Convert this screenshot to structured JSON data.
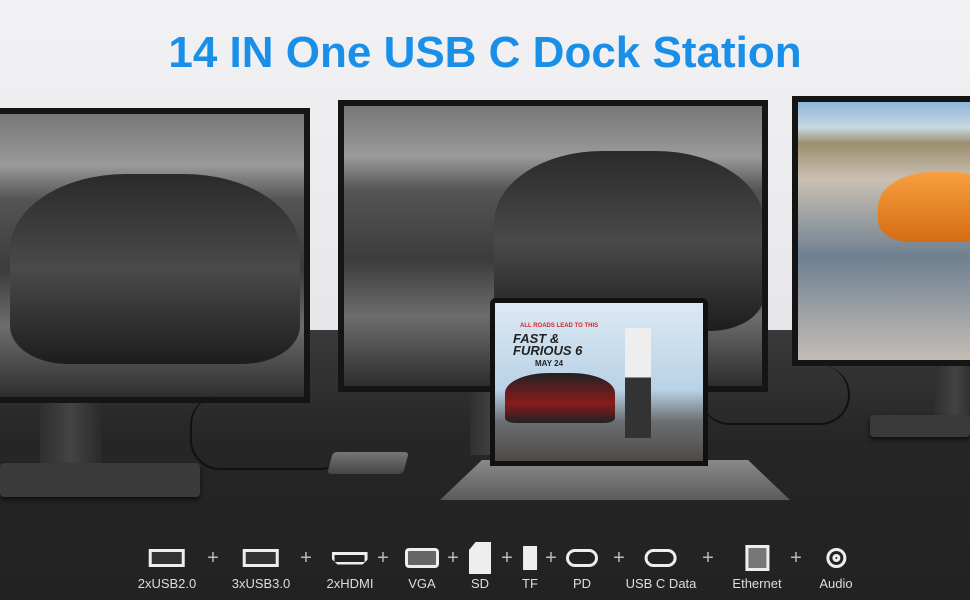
{
  "title": "14 IN One USB C Dock Station",
  "laptop_poster": {
    "tagline": "ALL ROADS LEAD TO THIS",
    "title": "FAST & FURIOUS 6",
    "date": "MAY 24"
  },
  "ports": [
    {
      "label": "2xUSB2.0",
      "icon": "usb-a-icon"
    },
    {
      "label": "3xUSB3.0",
      "icon": "usb-a-icon"
    },
    {
      "label": "2xHDMI",
      "icon": "hdmi-icon"
    },
    {
      "label": "VGA",
      "icon": "vga-icon"
    },
    {
      "label": "SD",
      "icon": "sd-card-icon"
    },
    {
      "label": "TF",
      "icon": "tf-card-icon"
    },
    {
      "label": "PD",
      "icon": "usb-c-icon"
    },
    {
      "label": "USB C Data",
      "icon": "usb-c-icon"
    },
    {
      "label": "Ethernet",
      "icon": "ethernet-icon"
    },
    {
      "label": "Audio",
      "icon": "audio-jack-icon"
    }
  ],
  "separator": "+",
  "colors": {
    "title": "#1a8fe8",
    "desk": "#2b2b2b",
    "background": "#f0f0f2"
  }
}
